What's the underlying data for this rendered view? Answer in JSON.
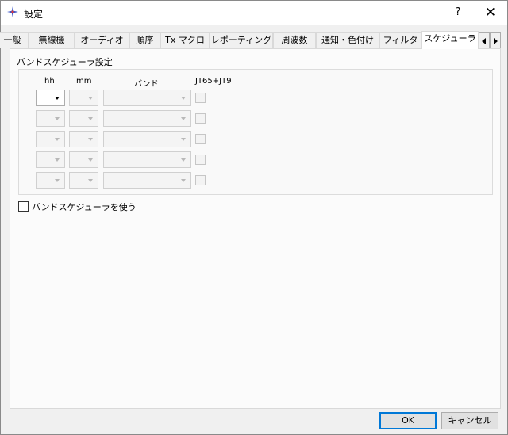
{
  "window": {
    "title": "設定",
    "help_label": "?",
    "close_label": "✕",
    "icon": "app-icon",
    "accent": "#0078d7"
  },
  "tabs": [
    {
      "label": "一般",
      "active": false
    },
    {
      "label": "無線機",
      "active": false
    },
    {
      "label": "オーディオ",
      "active": false
    },
    {
      "label": "順序",
      "active": false
    },
    {
      "label": "Tx マクロ",
      "active": false
    },
    {
      "label": "レポーティング",
      "active": false
    },
    {
      "label": "周波数",
      "active": false
    },
    {
      "label": "通知・色付け",
      "active": false
    },
    {
      "label": "フィルタ",
      "active": false
    },
    {
      "label": "スケジューラ",
      "active": true
    }
  ],
  "scheduler": {
    "group_title": "バンドスケジューラ設定",
    "columns": {
      "hh": "hh",
      "mm": "mm",
      "band": "バンド",
      "jt": "JT65+JT9"
    },
    "row_count": 5,
    "use_label": "バンドスケジューラを使う",
    "use_checked": false
  },
  "buttons": {
    "ok": "OK",
    "cancel": "キャンセル"
  }
}
